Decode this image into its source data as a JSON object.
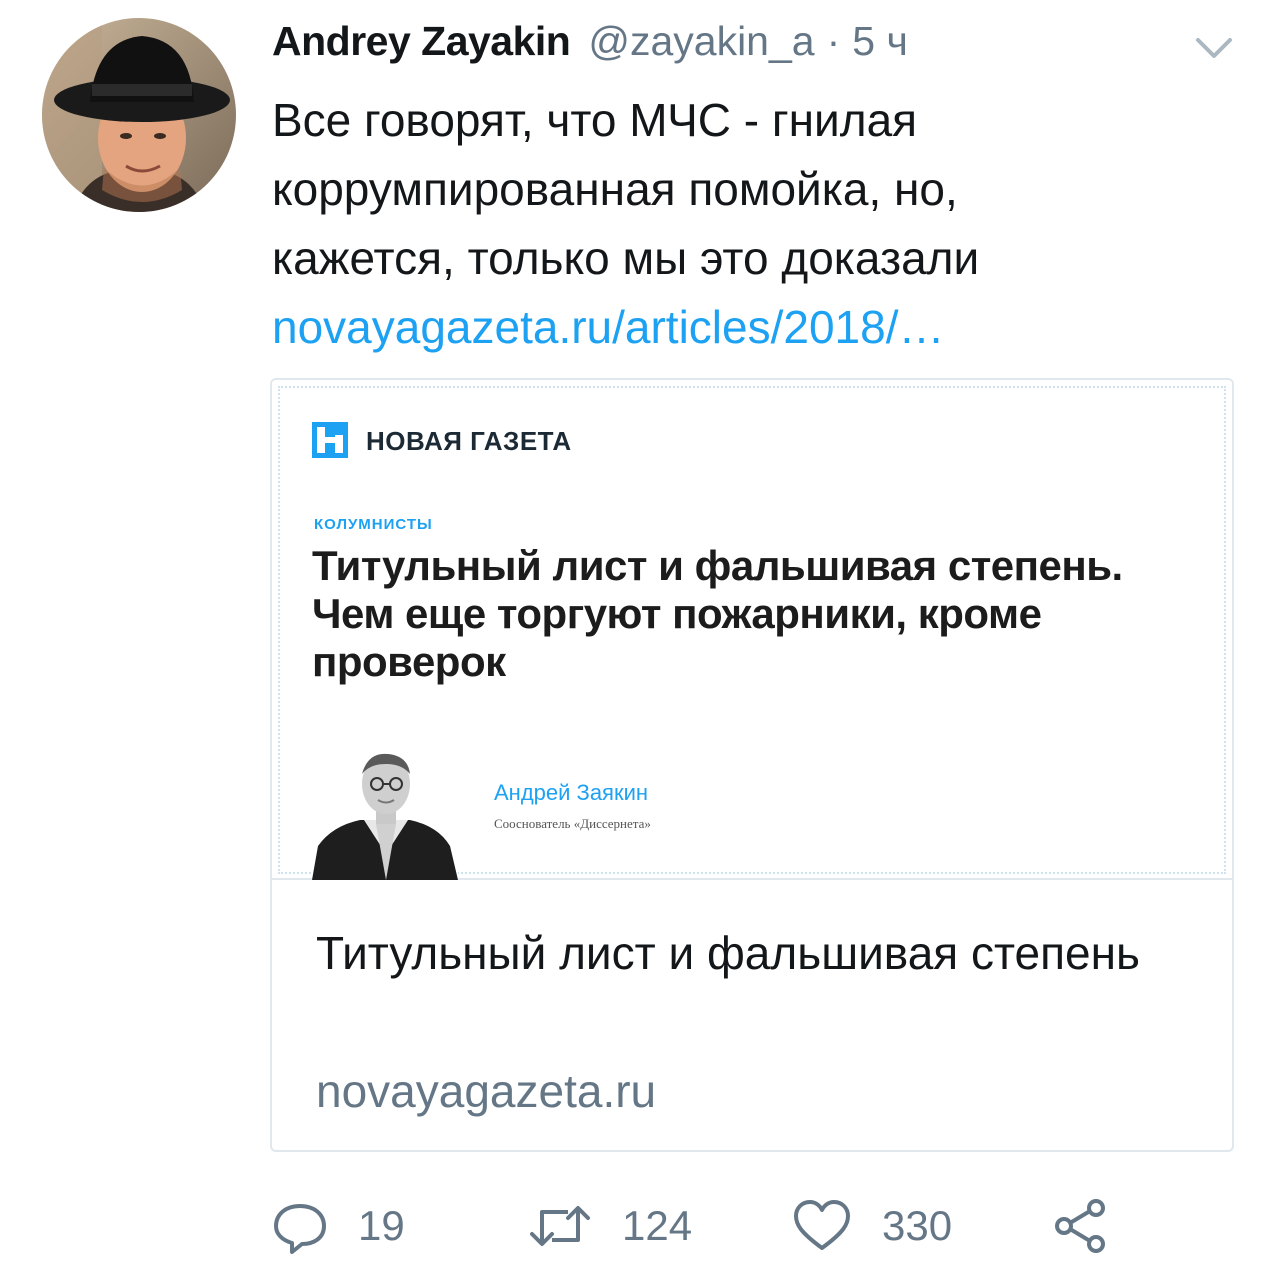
{
  "tweet": {
    "author": {
      "display_name": "Andrey Zayakin",
      "handle": "@zayakin_a"
    },
    "separator": "·",
    "timestamp": "5 ч",
    "text_lines": [
      "Все говорят, что МЧС - гнилая",
      "коррумпированная помойка, но,",
      "кажется, только мы это доказали"
    ],
    "link_text": "novayagazeta.ru/articles/2018/…"
  },
  "card": {
    "image": {
      "brand_name": "НОВАЯ ГАЗЕТА",
      "rubric": "КОЛУМНИСТЫ",
      "headline": "Титульный лист и фальшивая степень. Чем еще торгуют пожарники, кроме проверок",
      "author_name": "Андрей Заякин",
      "author_role": "Сооснователь «Диссернета»"
    },
    "title": "Титульный лист и фальшивая степень",
    "domain": "novayagazeta.ru"
  },
  "actions": {
    "reply_count": "19",
    "retweet_count": "124",
    "like_count": "330"
  },
  "colors": {
    "link": "#1da1f2",
    "secondary_text": "#657786",
    "border": "#e1e8ed",
    "icon": "#657786"
  },
  "icons": {
    "menu": "chevron-down-icon",
    "reply": "reply-bubble-icon",
    "retweet": "retweet-arrows-icon",
    "like": "heart-icon",
    "share": "share-nodes-icon"
  }
}
